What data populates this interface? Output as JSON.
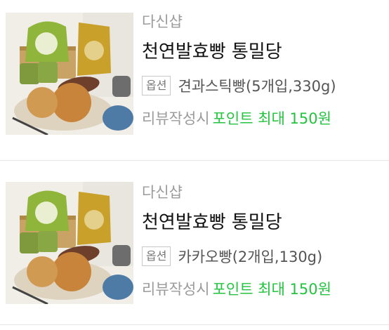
{
  "items": [
    {
      "shop": "다신샵",
      "title": "천연발효빵 통밀당",
      "option_badge": "옵션",
      "option_value": "견과스틱빵(5개입,330g)",
      "review_prefix": "리뷰작성시",
      "review_point": "포인트 최대 150원"
    },
    {
      "shop": "다신샵",
      "title": "천연발효빵 통밀당",
      "option_badge": "옵션",
      "option_value": "카카오빵(2개입,130g)",
      "review_prefix": "리뷰작성시",
      "review_point": "포인트 최대 150원"
    }
  ],
  "colors": {
    "accent_green": "#22c33e",
    "muted_text": "#9b9b9b"
  }
}
